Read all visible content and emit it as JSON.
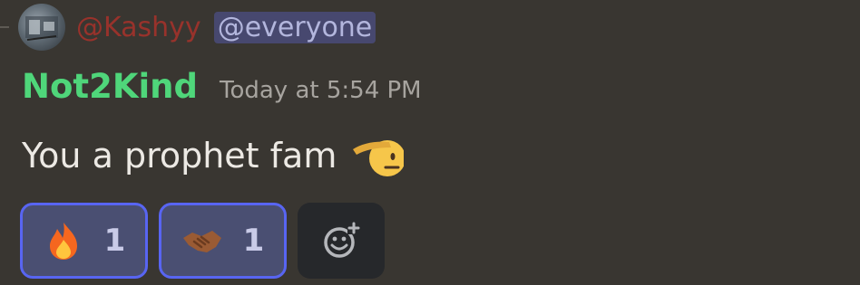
{
  "reply": {
    "author": "@Kashyy",
    "mention": "@everyone"
  },
  "message": {
    "author": "Not2Kind",
    "timestamp": "Today at 5:54 PM",
    "text": "You a prophet fam",
    "emoji": "saluting-face"
  },
  "reactions": [
    {
      "emoji": "fire",
      "count": "1"
    },
    {
      "emoji": "handshake",
      "count": "1"
    }
  ],
  "colors": {
    "background": "#393631",
    "username": "#4fd67a",
    "reply_author": "#b8312a",
    "reaction_border": "#5865f2"
  }
}
